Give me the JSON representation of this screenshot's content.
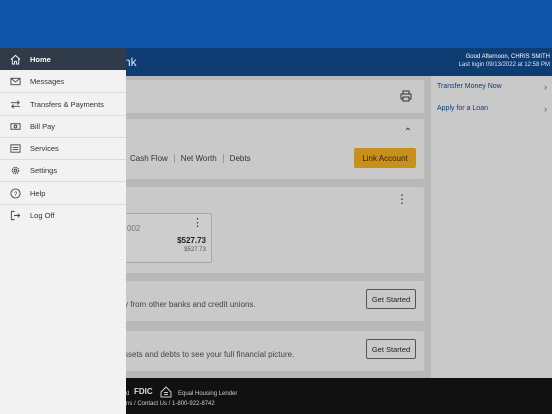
{
  "header": {
    "brand_fragment": "nk",
    "greeting": "Good Afternoon, CHRIS SMITH",
    "last_login": "Last login 09/13/2022 at 12:58 PM"
  },
  "financial_card": {
    "tabs": [
      "Cash Flow",
      "Net Worth",
      "Debts"
    ],
    "link_button": "Link Account"
  },
  "account_tile": {
    "number_fragment": "002",
    "balance": "$527.73",
    "available": "$527.73"
  },
  "link_card": {
    "text": "y from other banks and credit unions.",
    "button": "Get Started"
  },
  "ifp_card": {
    "text": "ssets and debts to see your full financial picture.",
    "button": "Get Started"
  },
  "right_panel": {
    "links": [
      "Transfer Money Now",
      "Apply for a Loan"
    ]
  },
  "footer": {
    "fragment": "d",
    "fdic": "FDIC",
    "equal_housing": "Equal Housing Lender",
    "links_line": "ns  /  Contact Us  /  1-800-922-8742"
  },
  "drawer": {
    "items": [
      {
        "label": "Home",
        "icon": "home-icon"
      },
      {
        "label": "Messages",
        "icon": "envelope-icon"
      },
      {
        "label": "Transfers & Payments",
        "icon": "transfer-icon"
      },
      {
        "label": "Bill Pay",
        "icon": "bill-icon"
      },
      {
        "label": "Services",
        "icon": "services-icon"
      },
      {
        "label": "Settings",
        "icon": "gear-icon"
      },
      {
        "label": "Help",
        "icon": "help-icon"
      },
      {
        "label": "Log Off",
        "icon": "logout-icon"
      }
    ]
  },
  "colors": {
    "status_band": "#0f54a8",
    "header": "#0e3d74",
    "drawer_active": "#2f3b49",
    "link_account_button": "#c7901c"
  }
}
